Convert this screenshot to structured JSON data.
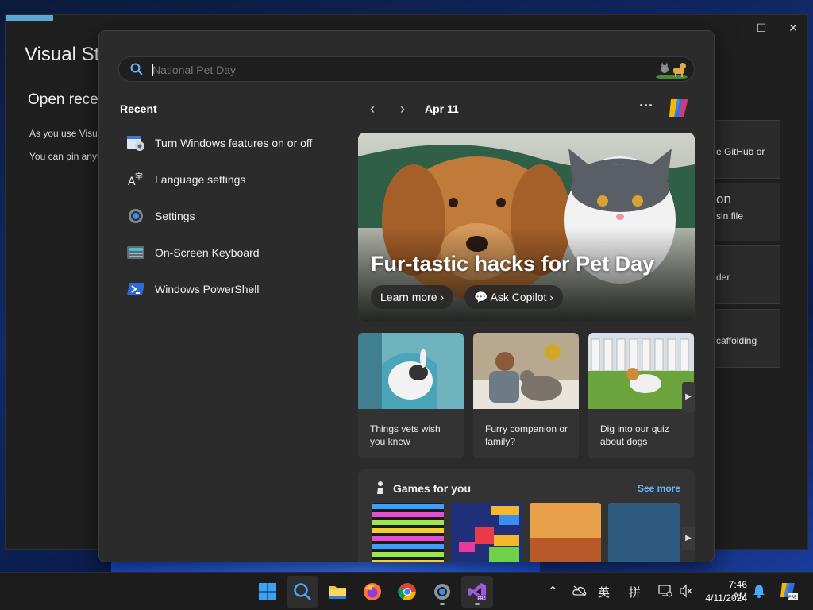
{
  "background_window": {
    "title": "Visual Stu",
    "open_recent": "Open recen",
    "line1": "As you use Visua",
    "line2": "You can pin anyt",
    "cards": [
      {
        "text": "e GitHub or"
      },
      {
        "title": "on",
        "text": "sln file"
      },
      {
        "text": "der"
      },
      {
        "text": "caffolding"
      }
    ]
  },
  "search": {
    "placeholder": "National Pet Day"
  },
  "recent": {
    "heading": "Recent",
    "items": [
      {
        "label": "Turn Windows features on or off",
        "icon": "windows-features-icon"
      },
      {
        "label": "Language settings",
        "icon": "language-icon"
      },
      {
        "label": "Settings",
        "icon": "gear-icon"
      },
      {
        "label": "On-Screen Keyboard",
        "icon": "keyboard-icon"
      },
      {
        "label": "Windows PowerShell",
        "icon": "powershell-icon"
      }
    ]
  },
  "highlights": {
    "date": "Apr 11",
    "hero": {
      "title": "Fur-tastic hacks for Pet Day",
      "learn_more": "Learn more",
      "ask_copilot": "Ask Copilot"
    },
    "cards": [
      {
        "title": "Things vets wish you knew"
      },
      {
        "title": "Furry companion or family?"
      },
      {
        "title": "Dig into our quiz about dogs"
      }
    ],
    "games": {
      "title": "Games for you",
      "see_more": "See more"
    }
  },
  "taskbar": {
    "apps": [
      "start-icon",
      "search-icon",
      "file-explorer-icon",
      "firefox-icon",
      "chrome-icon",
      "settings-icon",
      "visual-studio-preview-icon"
    ],
    "tray": {
      "ime1": "英",
      "ime2": "拼",
      "time": "7:46 AM",
      "date": "4/11/2024"
    }
  },
  "colors": {
    "accent": "#6fb3ff",
    "panel": "#2b2b2b",
    "taskbar": "#1c1c1c"
  }
}
